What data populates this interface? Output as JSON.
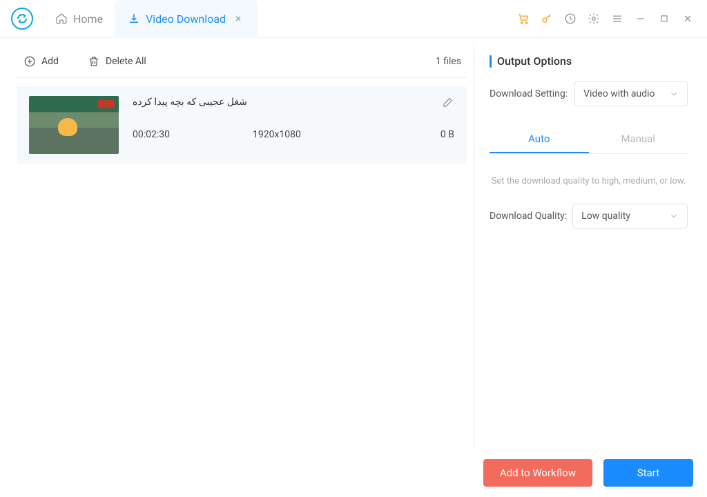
{
  "tabs": {
    "home": "Home",
    "active": "Video Download"
  },
  "toolbar": {
    "add": "Add",
    "delete_all": "Delete All",
    "file_count": "1 files"
  },
  "file": {
    "title": "شغل عجیبی که بچه پیدا کرده",
    "duration": "00:02:30",
    "resolution": "1920x1080",
    "size": "0 B"
  },
  "output": {
    "title": "Output Options",
    "download_setting_label": "Download Setting:",
    "download_setting_value": "Video with audio",
    "tab_auto": "Auto",
    "tab_manual": "Manual",
    "help": "Set the download quality to high, medium, or low.",
    "download_quality_label": "Download Quality:",
    "download_quality_value": "Low quality"
  },
  "footer": {
    "add_workflow": "Add to Workflow",
    "start": "Start"
  }
}
